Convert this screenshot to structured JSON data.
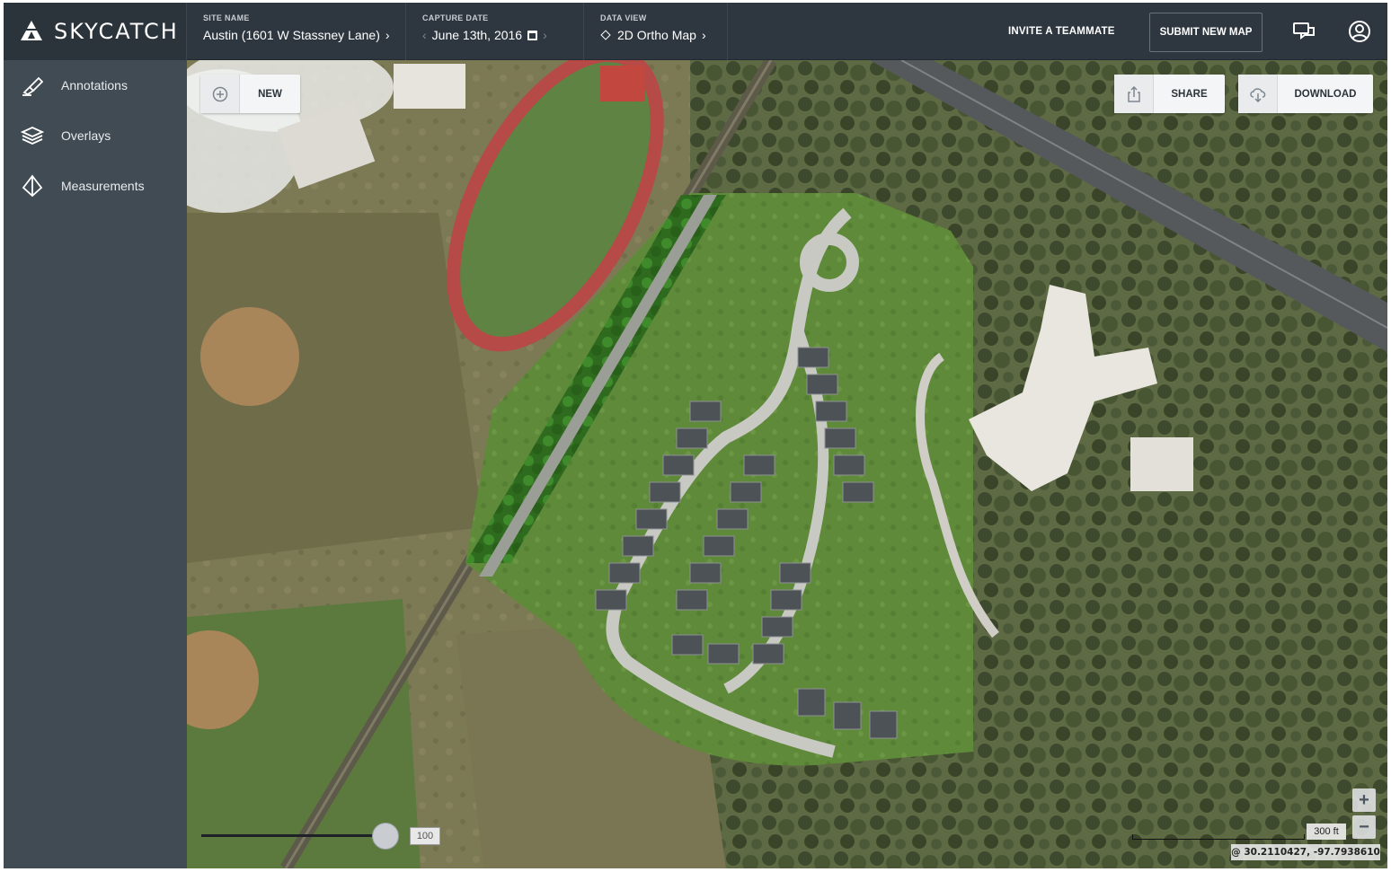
{
  "brand": {
    "name": "SKYCATCH"
  },
  "header": {
    "site": {
      "label": "SITE NAME",
      "value": "Austin (1601 W Stassney Lane)"
    },
    "capture_date": {
      "label": "CAPTURE DATE",
      "value": "June 13th, 2016"
    },
    "data_view": {
      "label": "DATA VIEW",
      "value": "2D Ortho Map"
    },
    "invite_label": "INVITE A TEAMMATE",
    "submit_label": "SUBMIT NEW MAP"
  },
  "sidebar": {
    "items": [
      {
        "label": "Annotations",
        "icon": "annotation-icon"
      },
      {
        "label": "Overlays",
        "icon": "layers-icon"
      },
      {
        "label": "Measurements",
        "icon": "measure-icon"
      }
    ]
  },
  "map": {
    "new_label": "NEW",
    "share_label": "SHARE",
    "download_label": "DOWNLOAD",
    "opacity_value": "100",
    "scale_label": "300 ft",
    "coordinates": "@  30.2110427,  -97.7938610",
    "zoom_in": "+",
    "zoom_out": "−"
  },
  "colors": {
    "header_bg": "#2e3740",
    "sidebar_bg": "#414b54",
    "button_bg": "#f4f5f6"
  }
}
